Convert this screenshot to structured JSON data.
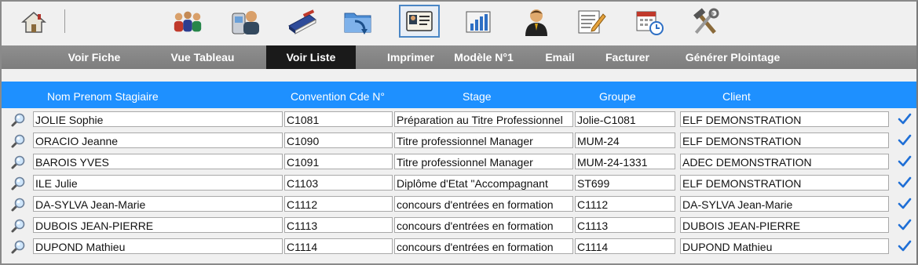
{
  "toolbar": {
    "icons": [
      "home-icon",
      "group-icon",
      "contact-phone-icon",
      "book-icon",
      "folder-import-icon",
      "id-card-icon",
      "bar-chart-icon",
      "person-icon",
      "notepad-edit-icon",
      "calendar-clock-icon",
      "tools-icon"
    ],
    "active_icon": "id-card-icon"
  },
  "menu": {
    "items": [
      {
        "label": "Voir Fiche"
      },
      {
        "label": "Vue Tableau"
      },
      {
        "label": "Voir Liste"
      },
      {
        "label": "Imprimer"
      },
      {
        "label": "Modèle N°1"
      },
      {
        "label": "Email"
      },
      {
        "label": "Facturer"
      },
      {
        "label": "Générer Plointage"
      }
    ],
    "active": "Voir Liste"
  },
  "table": {
    "columns": [
      "Nom Prenom Stagiaire",
      "Convention Cde N°",
      "Stage",
      "Groupe",
      "Client"
    ],
    "rows": [
      {
        "nom": "JOLIE Sophie",
        "convention": "C1081",
        "stage": "Préparation au Titre Professionnel",
        "groupe": "Jolie-C1081",
        "client": "ELF DEMONSTRATION"
      },
      {
        "nom": "ORACIO Jeanne",
        "convention": "C1090",
        "stage": "Titre professionnel Manager",
        "groupe": "MUM-24",
        "client": "ELF DEMONSTRATION"
      },
      {
        "nom": "BAROIS YVES",
        "convention": "C1091",
        "stage": "Titre professionnel Manager",
        "groupe": "MUM-24-1331",
        "client": "ADEC DEMONSTRATION"
      },
      {
        "nom": "ILE Julie",
        "convention": "C1103",
        "stage": "Diplôme d'Etat \"Accompagnant",
        "groupe": "ST699",
        "client": "ELF DEMONSTRATION"
      },
      {
        "nom": "DA-SYLVA Jean-Marie",
        "convention": "C1112",
        "stage": "concours d'entrées en formation",
        "groupe": "C1112",
        "client": "DA-SYLVA Jean-Marie"
      },
      {
        "nom": "DUBOIS JEAN-PIERRE",
        "convention": "C1113",
        "stage": "concours d'entrées en formation",
        "groupe": "C1113",
        "client": "DUBOIS JEAN-PIERRE"
      },
      {
        "nom": "DUPOND Mathieu",
        "convention": "C1114",
        "stage": "concours d'entrées en formation",
        "groupe": "C1114",
        "client": "DUPOND Mathieu"
      }
    ]
  },
  "colors": {
    "header_blue": "#1e90ff",
    "menubar_gray": "#858585",
    "active_menu": "#1a1a1a",
    "check_blue": "#1f6fd6"
  }
}
